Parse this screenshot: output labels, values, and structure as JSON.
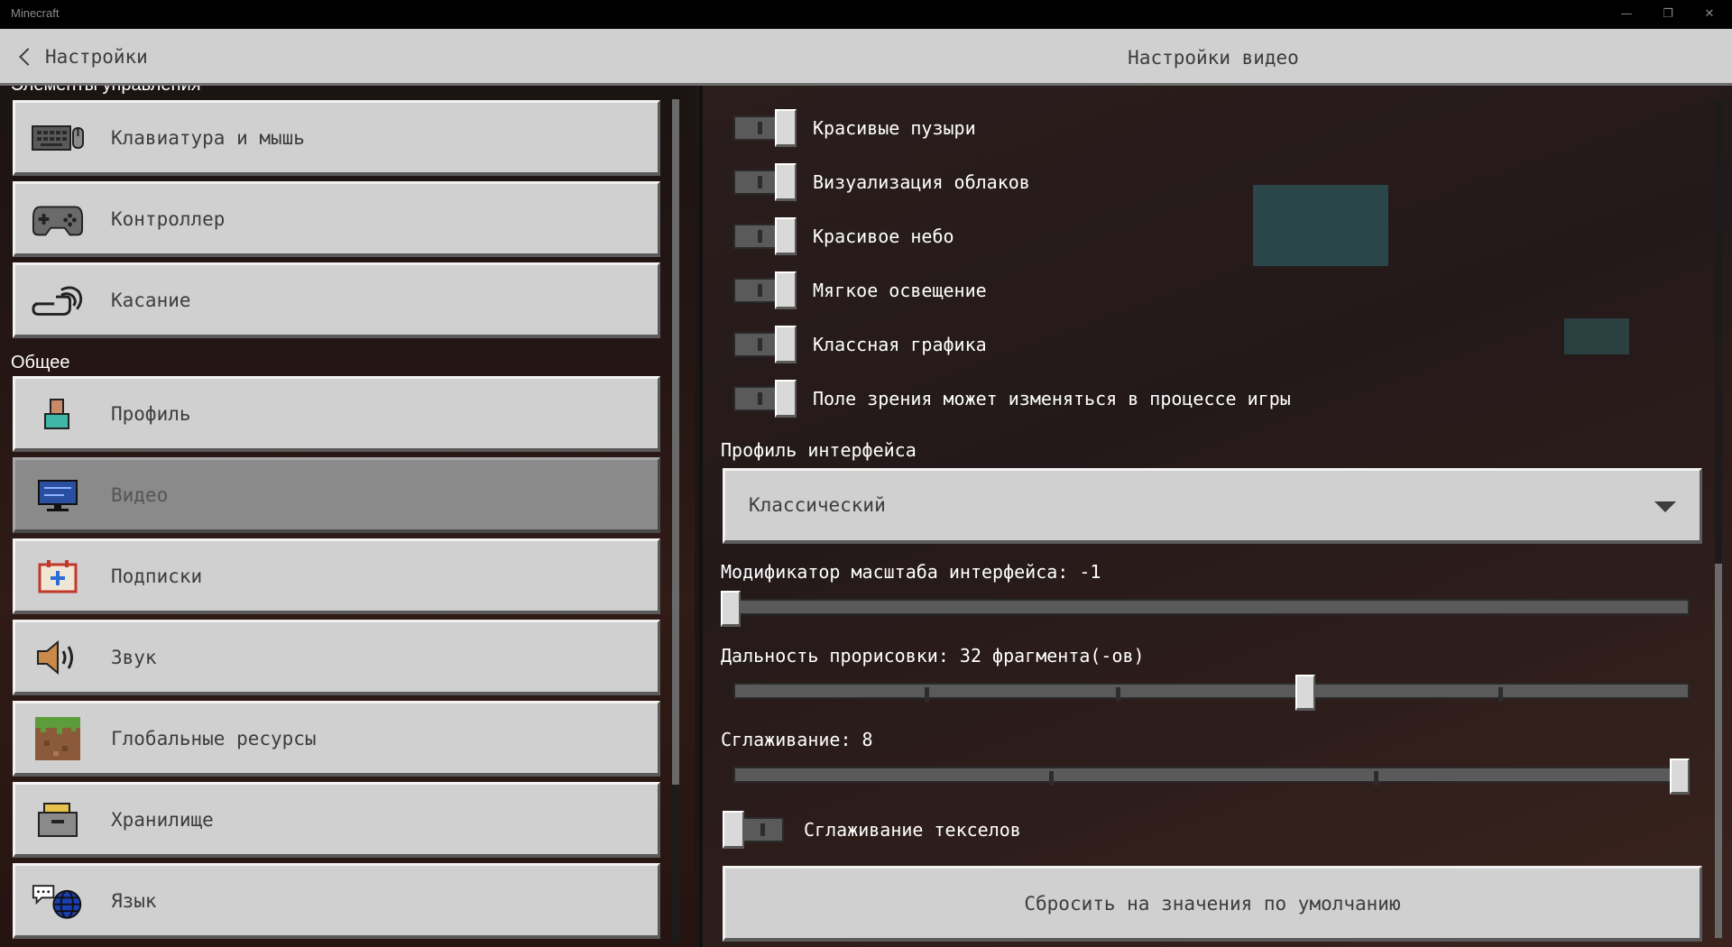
{
  "window": {
    "app_title": "Minecraft",
    "minimize_glyph": "—",
    "restore_glyph": "❐",
    "close_glyph": "✕"
  },
  "header": {
    "back_label": "Настройки",
    "title": "Настройки видео"
  },
  "sidebar": {
    "section_controls_partial": "Элементы управления",
    "section_general": "Общее",
    "items": [
      {
        "label": "Клавиатура и мышь",
        "icon": "keyboard-mouse-icon"
      },
      {
        "label": "Контроллер",
        "icon": "controller-icon"
      },
      {
        "label": "Касание",
        "icon": "touch-icon"
      },
      {
        "label": "Профиль",
        "icon": "profile-icon"
      },
      {
        "label": "Видео",
        "icon": "monitor-icon",
        "selected": true
      },
      {
        "label": "Подписки",
        "icon": "subscriptions-icon"
      },
      {
        "label": "Звук",
        "icon": "speaker-icon"
      },
      {
        "label": "Глобальные ресурсы",
        "icon": "grass-block-icon"
      },
      {
        "label": "Хранилище",
        "icon": "storage-icon"
      },
      {
        "label": "Язык",
        "icon": "language-globe-icon"
      }
    ]
  },
  "video": {
    "toggles": [
      {
        "label": "Красивые пузыри",
        "on": true
      },
      {
        "label": "Визуализация облаков",
        "on": true
      },
      {
        "label": "Красивое небо",
        "on": true
      },
      {
        "label": "Мягкое освещение",
        "on": true
      },
      {
        "label": "Классная графика",
        "on": true
      },
      {
        "label": "Поле зрения может изменяться в процессе игры",
        "on": true
      }
    ],
    "ui_profile": {
      "label": "Профиль интерфейса",
      "value": "Классический"
    },
    "gui_scale": {
      "label": "Модификатор масштаба интерфейса: -1",
      "fraction": 0.0
    },
    "render_distance": {
      "label": "Дальность прорисовки: 32 фрагмента(-ов)",
      "fraction": 0.6,
      "ticks": [
        0.2,
        0.4,
        0.8
      ]
    },
    "antialiasing": {
      "label": "Сглаживание: 8",
      "fraction": 1.0,
      "ticks": [
        0.33,
        0.67
      ]
    },
    "texel_aa": {
      "label": "Сглаживание текселов",
      "on": false
    },
    "reset_label": "Сбросить на значения по умолчанию"
  }
}
